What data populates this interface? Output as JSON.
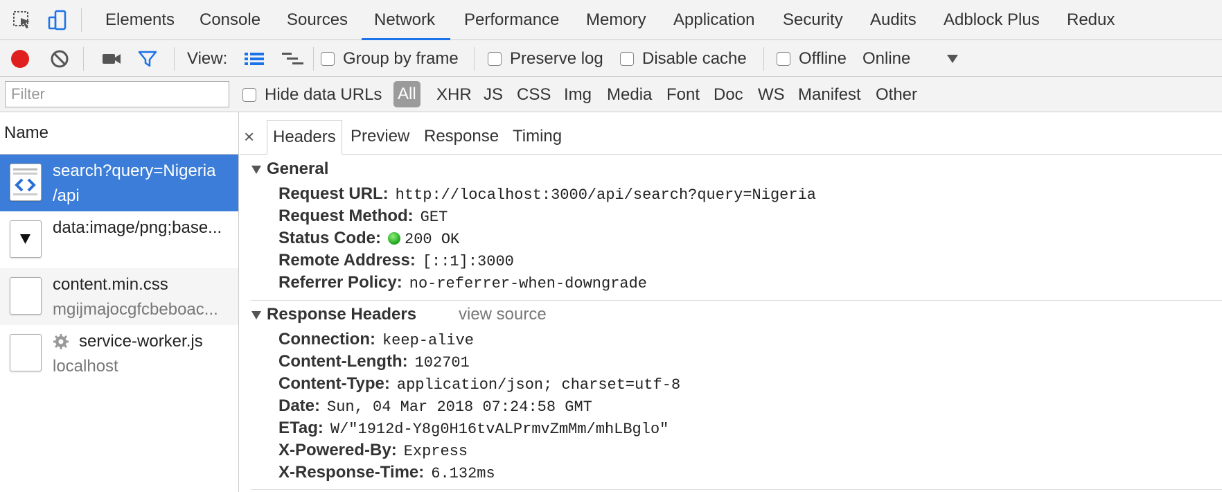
{
  "devtools_tabs": [
    "Elements",
    "Console",
    "Sources",
    "Network",
    "Performance",
    "Memory",
    "Application",
    "Security",
    "Audits",
    "Adblock Plus",
    "Redux"
  ],
  "selected_tab": "Network",
  "toolbar": {
    "view_label": "View:",
    "group_by_frame": "Group by frame",
    "preserve_log": "Preserve log",
    "disable_cache": "Disable cache",
    "offline": "Offline",
    "throttle_value": "Online"
  },
  "filterbar": {
    "placeholder": "Filter",
    "hide_data_urls": "Hide data URLs",
    "types": [
      "All",
      "XHR",
      "JS",
      "CSS",
      "Img",
      "Media",
      "Font",
      "Doc",
      "WS",
      "Manifest",
      "Other"
    ]
  },
  "requests": {
    "header": "Name",
    "items": [
      {
        "name": "search?query=Nigeria",
        "path": "/api"
      },
      {
        "name": "data:image/png;base...",
        "path": ""
      },
      {
        "name": "content.min.css",
        "path": "mgijmajocgfcbeboac..."
      },
      {
        "name": "service-worker.js",
        "path": "localhost"
      }
    ]
  },
  "detail_tabs": [
    "Headers",
    "Preview",
    "Response",
    "Timing"
  ],
  "close_glyph": "×",
  "general": {
    "title": "General",
    "fields": [
      {
        "key": "Request URL:",
        "value": "http://localhost:3000/api/search?query=Nigeria"
      },
      {
        "key": "Request Method:",
        "value": "GET"
      },
      {
        "key": "Status Code:",
        "value": "200 OK"
      },
      {
        "key": "Remote Address:",
        "value": "[::1]:3000"
      },
      {
        "key": "Referrer Policy:",
        "value": "no-referrer-when-downgrade"
      }
    ]
  },
  "response_headers": {
    "title": "Response Headers",
    "view_source": "view source",
    "fields": [
      {
        "key": "Connection:",
        "value": "keep-alive"
      },
      {
        "key": "Content-Length:",
        "value": "102701"
      },
      {
        "key": "Content-Type:",
        "value": "application/json; charset=utf-8"
      },
      {
        "key": "Date:",
        "value": "Sun, 04 Mar 2018 07:24:58 GMT"
      },
      {
        "key": "ETag:",
        "value": "W/\"1912d-Y8g0H16tvALPrmvZmMm/mhLBglo\""
      },
      {
        "key": "X-Powered-By:",
        "value": "Express"
      },
      {
        "key": "X-Response-Time:",
        "value": "6.132ms"
      }
    ]
  },
  "colors": {
    "accent": "#1a73e8",
    "selected_row": "#3b7dd8",
    "record": "#e0201f",
    "status_ok": "#1aa31a"
  }
}
